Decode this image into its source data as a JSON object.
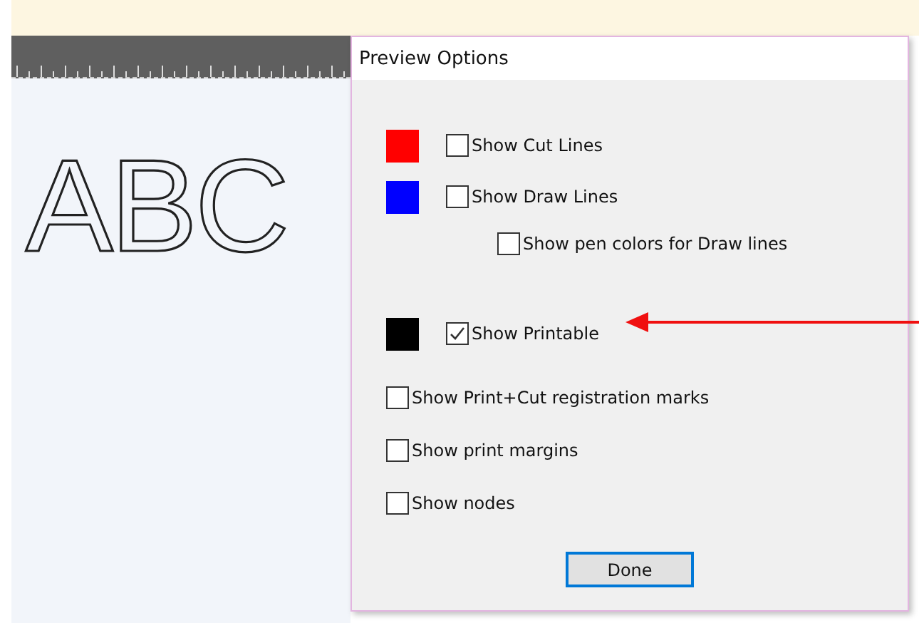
{
  "canvas": {
    "text": "ABC"
  },
  "dialog": {
    "title": "Preview Options",
    "sections": [
      [
        {
          "kind": "swatch",
          "color": "#ff0000",
          "label": "Show Cut Lines",
          "checked": false
        },
        {
          "kind": "swatch",
          "color": "#0000ff",
          "label": "Show Draw Lines",
          "checked": false
        },
        {
          "kind": "indented",
          "label": "Show pen colors for Draw lines",
          "checked": false
        }
      ],
      [
        {
          "kind": "swatch",
          "color": "#000000",
          "label": "Show Printable",
          "checked": true
        }
      ],
      [
        {
          "kind": "plain",
          "label": "Show Print+Cut registration marks",
          "checked": false
        },
        {
          "kind": "plain",
          "label": "Show print margins",
          "checked": false
        },
        {
          "kind": "plain",
          "label": "Show nodes",
          "checked": false
        }
      ]
    ],
    "button": "Done"
  }
}
